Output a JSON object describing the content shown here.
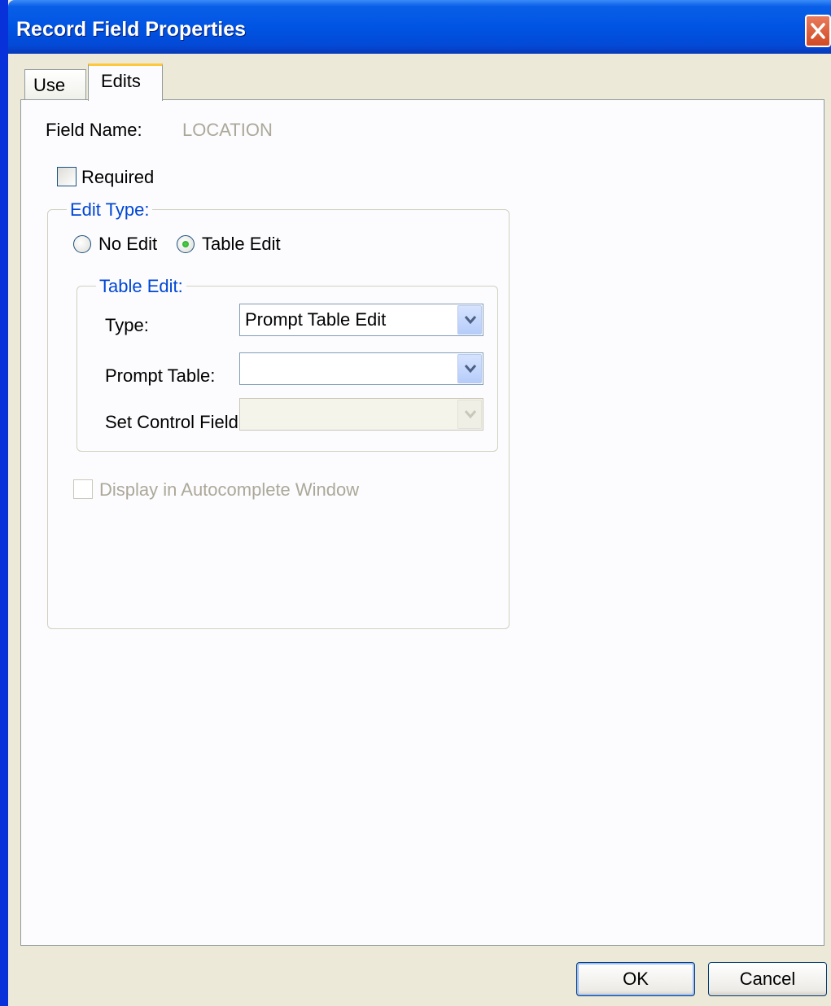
{
  "window": {
    "title": "Record Field Properties"
  },
  "tabs": [
    {
      "label": "Use",
      "active": false
    },
    {
      "label": "Edits",
      "active": true
    }
  ],
  "form": {
    "field_name_label": "Field Name:",
    "field_name_value": "LOCATION",
    "required_label": "Required",
    "required_checked": false,
    "edit_type": {
      "legend": "Edit Type:",
      "options": [
        {
          "label": "No Edit",
          "selected": false
        },
        {
          "label": "Table Edit",
          "selected": true
        }
      ]
    },
    "table_edit": {
      "legend": "Table Edit:",
      "type_label": "Type:",
      "type_value": "Prompt Table Edit",
      "prompt_table_label": "Prompt Table:",
      "prompt_table_value": "",
      "set_control_field_label": "Set Control Field:",
      "set_control_field_value": ""
    },
    "autocomplete_label": "Display in Autocomplete Window",
    "autocomplete_checked": false
  },
  "buttons": {
    "ok": "OK",
    "cancel": "Cancel"
  },
  "colors": {
    "title_bar": "#0054e3",
    "legend_text": "#0046d5",
    "tab_highlight": "#ffc83c",
    "dialog_bg": "#ece9d8"
  },
  "icons": {
    "close": "close-icon",
    "dropdown": "chevron-down-icon"
  }
}
